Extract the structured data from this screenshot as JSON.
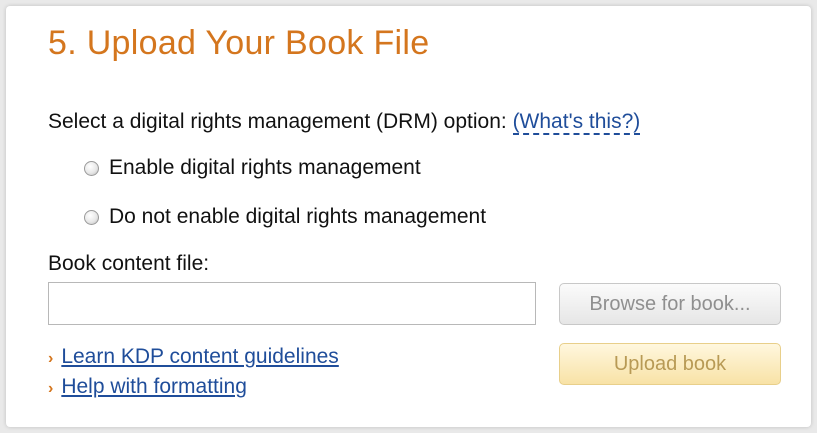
{
  "section": {
    "title": "5. Upload Your Book File"
  },
  "drm": {
    "prompt": "Select a digital rights management (DRM) option:",
    "whats_this": "(What's this?)",
    "options": [
      {
        "label": "Enable digital rights management",
        "selected": false
      },
      {
        "label": "Do not enable digital rights management",
        "selected": false
      }
    ]
  },
  "file": {
    "label": "Book content file:",
    "value": "",
    "browse_label": "Browse for book...",
    "upload_label": "Upload book"
  },
  "links": [
    {
      "label": "Learn KDP content guidelines"
    },
    {
      "label": "Help with formatting"
    }
  ],
  "colors": {
    "title": "#d4761e",
    "link": "#1f4d9a",
    "upload_button": "#f8e2a6"
  }
}
